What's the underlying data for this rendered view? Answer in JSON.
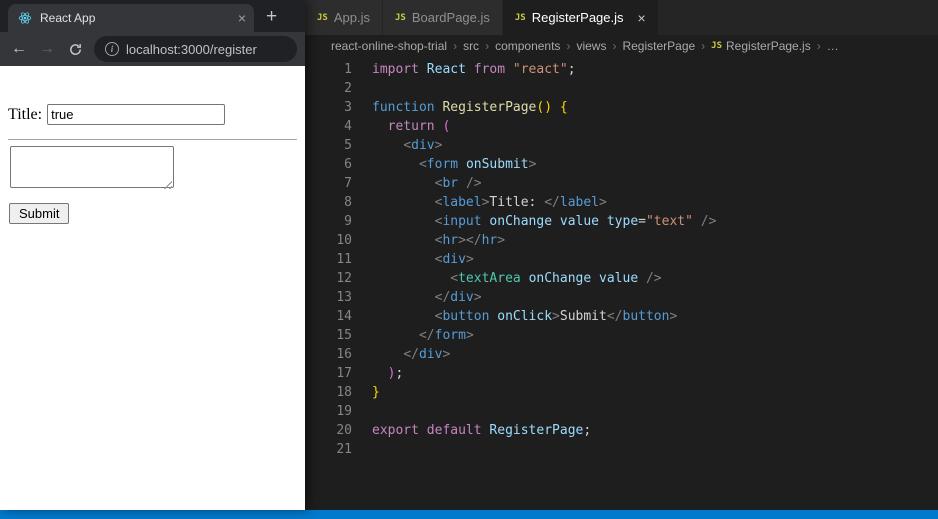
{
  "browser": {
    "tab_title": "React App",
    "url": "localhost:3000/register",
    "icons": {
      "close": "×",
      "new_tab": "+",
      "back": "←",
      "forward": "→",
      "info": "i",
      "react_logo": "atom"
    },
    "page": {
      "title_label": "Title:",
      "input_value": "true",
      "submit_label": "Submit"
    }
  },
  "vscode": {
    "tabs": [
      {
        "icon": "JS",
        "label": "App.js",
        "active": false
      },
      {
        "icon": "JS",
        "label": "BoardPage.js",
        "active": false
      },
      {
        "icon": "JS",
        "label": "RegisterPage.js",
        "active": true,
        "close": "×"
      }
    ],
    "breadcrumb": [
      {
        "label": "react-online-shop-trial"
      },
      {
        "label": "src"
      },
      {
        "label": "components"
      },
      {
        "label": "views"
      },
      {
        "label": "RegisterPage"
      },
      {
        "label": "RegisterPage.js",
        "icon": "JS"
      },
      {
        "label": "…"
      }
    ],
    "breadcrumb_separator": "›",
    "theme": {
      "kw": "#C586C0",
      "kw2": "#569CD6",
      "fn": "#DCDCAA",
      "var": "#9CDCFE",
      "str": "#CE9178",
      "tag": "#569CD6",
      "attr": "#9CDCFE",
      "comp": "#4EC9B0",
      "punc": "#808080",
      "fg": "#D4D4D4",
      "b1": "#FFD700",
      "b2": "#DA70D6",
      "status_bar": "#007ACC",
      "editor_bg": "#1E1E1E",
      "line_number": "#858585"
    },
    "code_lines": [
      [
        [
          "import",
          "kw"
        ],
        [
          " ",
          ""
        ],
        [
          "React",
          "var"
        ],
        [
          " ",
          ""
        ],
        [
          "from",
          "kw"
        ],
        [
          " ",
          ""
        ],
        [
          "\"react\"",
          "str"
        ],
        [
          ";",
          "fg"
        ]
      ],
      [],
      [
        [
          "function",
          "kw2"
        ],
        [
          " ",
          ""
        ],
        [
          "RegisterPage",
          "fn"
        ],
        [
          "()",
          "b1"
        ],
        [
          " ",
          ""
        ],
        [
          "{",
          "b1"
        ]
      ],
      [
        [
          "  ",
          ""
        ],
        [
          "return",
          "kw"
        ],
        [
          " ",
          ""
        ],
        [
          "(",
          "b2"
        ]
      ],
      [
        [
          "    ",
          ""
        ],
        [
          "<",
          "punc"
        ],
        [
          "div",
          "tag"
        ],
        [
          ">",
          "punc"
        ]
      ],
      [
        [
          "      ",
          ""
        ],
        [
          "<",
          "punc"
        ],
        [
          "form",
          "tag"
        ],
        [
          " ",
          ""
        ],
        [
          "onSubmit",
          "attr"
        ],
        [
          ">",
          "punc"
        ]
      ],
      [
        [
          "        ",
          ""
        ],
        [
          "<",
          "punc"
        ],
        [
          "br",
          "tag"
        ],
        [
          " ",
          ""
        ],
        [
          "/>",
          "punc"
        ]
      ],
      [
        [
          "        ",
          ""
        ],
        [
          "<",
          "punc"
        ],
        [
          "label",
          "tag"
        ],
        [
          ">",
          "punc"
        ],
        [
          "Title: ",
          "fg"
        ],
        [
          "</",
          "punc"
        ],
        [
          "label",
          "tag"
        ],
        [
          ">",
          "punc"
        ]
      ],
      [
        [
          "        ",
          ""
        ],
        [
          "<",
          "punc"
        ],
        [
          "input",
          "tag"
        ],
        [
          " ",
          ""
        ],
        [
          "onChange",
          "attr"
        ],
        [
          " ",
          ""
        ],
        [
          "value",
          "attr"
        ],
        [
          " ",
          ""
        ],
        [
          "type",
          "attr"
        ],
        [
          "=",
          "fg"
        ],
        [
          "\"text\"",
          "str"
        ],
        [
          " ",
          ""
        ],
        [
          "/>",
          "punc"
        ]
      ],
      [
        [
          "        ",
          ""
        ],
        [
          "<",
          "punc"
        ],
        [
          "hr",
          "tag"
        ],
        [
          "></",
          "punc"
        ],
        [
          "hr",
          "tag"
        ],
        [
          ">",
          "punc"
        ]
      ],
      [
        [
          "        ",
          ""
        ],
        [
          "<",
          "punc"
        ],
        [
          "div",
          "tag"
        ],
        [
          ">",
          "punc"
        ]
      ],
      [
        [
          "          ",
          ""
        ],
        [
          "<",
          "punc"
        ],
        [
          "textArea",
          "comp"
        ],
        [
          " ",
          ""
        ],
        [
          "onChange",
          "attr"
        ],
        [
          " ",
          ""
        ],
        [
          "value",
          "attr"
        ],
        [
          " ",
          ""
        ],
        [
          "/>",
          "punc"
        ]
      ],
      [
        [
          "        ",
          ""
        ],
        [
          "</",
          "punc"
        ],
        [
          "div",
          "tag"
        ],
        [
          ">",
          "punc"
        ]
      ],
      [
        [
          "        ",
          ""
        ],
        [
          "<",
          "punc"
        ],
        [
          "button",
          "tag"
        ],
        [
          " ",
          ""
        ],
        [
          "onClick",
          "attr"
        ],
        [
          ">",
          "punc"
        ],
        [
          "Submit",
          "fg"
        ],
        [
          "</",
          "punc"
        ],
        [
          "button",
          "tag"
        ],
        [
          ">",
          "punc"
        ]
      ],
      [
        [
          "      ",
          ""
        ],
        [
          "</",
          "punc"
        ],
        [
          "form",
          "tag"
        ],
        [
          ">",
          "punc"
        ]
      ],
      [
        [
          "    ",
          ""
        ],
        [
          "</",
          "punc"
        ],
        [
          "div",
          "tag"
        ],
        [
          ">",
          "punc"
        ]
      ],
      [
        [
          "  ",
          ""
        ],
        [
          ")",
          "b2"
        ],
        [
          ";",
          "fg"
        ]
      ],
      [
        [
          "}",
          "b1"
        ]
      ],
      [],
      [
        [
          "export",
          "kw"
        ],
        [
          " ",
          ""
        ],
        [
          "default",
          "kw"
        ],
        [
          " ",
          ""
        ],
        [
          "RegisterPage",
          "var"
        ],
        [
          ";",
          "fg"
        ]
      ],
      []
    ]
  }
}
